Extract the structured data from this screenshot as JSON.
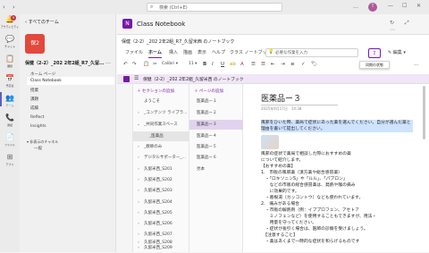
{
  "window": {
    "search_placeholder": "検索 (Ctrl+E)",
    "more": "…",
    "avatar_initial": "T",
    "min": "—",
    "max": "☐",
    "close": "✕"
  },
  "rail": {
    "notifications_badge": "9",
    "items": [
      {
        "label": "アクティビティ",
        "icon": "bell-icon",
        "glyph": "🔔"
      },
      {
        "label": "チャット",
        "icon": "chat-icon",
        "glyph": "💬"
      },
      {
        "label": "チーム",
        "icon": "teams-icon",
        "glyph": "👥"
      },
      {
        "label": "課題",
        "icon": "assignments-icon",
        "glyph": "📋"
      },
      {
        "label": "予定表",
        "icon": "calendar-icon",
        "glyph": "📅"
      },
      {
        "label": "通話",
        "icon": "phone-icon",
        "glyph": "📞"
      },
      {
        "label": "ファイル",
        "icon": "files-icon",
        "glyph": "📄"
      },
      {
        "label": "アプリ",
        "icon": "apps-icon",
        "glyph": "⊞"
      }
    ]
  },
  "team_pane": {
    "all_teams": "‹  すべてのチーム",
    "team_tile": "保2",
    "team_name": "保健（2-2）_202 2年2組_R7_久留...",
    "more": "…",
    "home_page": "ホーム ページ",
    "channels": [
      "Class Notebook",
      "授業",
      "課題",
      "成績",
      "Reflect",
      "Insights"
    ],
    "active_channel": "Class Notebook",
    "hidden_label": "▾ 非表示のチャネル",
    "hidden_item": "一般"
  },
  "app": {
    "icon_letter": "N",
    "title": "Class Notebook",
    "header_icons": "↻ ⤢ ⋯",
    "breadcrumb": "保健（2-2）_202 2年2組_R7_久留米西 のノートブック"
  },
  "ribbon": {
    "tabs": [
      "ファイル",
      "ホーム",
      "挿入",
      "描画",
      "表示",
      "ヘルプ",
      "クラス ノートブック"
    ],
    "active_tab": "ホーム",
    "search_placeholder": "必要な作業を入力",
    "share_glyph": "⇪",
    "edit_label": "✎ 編集 ▾",
    "tooltip": "同期の状態",
    "toolbar": [
      "↶",
      "↷",
      "📋",
      "✂",
      "Calibri ▾",
      "11 ▾",
      "B",
      "I",
      "U",
      "ab",
      "A",
      "☰",
      "☰",
      "⇤",
      "⇥",
      "≡",
      "✓",
      "🏷",
      "…"
    ]
  },
  "notebook": {
    "toggle": "☰",
    "title": "保健（2-2）_202 2年2組_久留米西 のノートブック",
    "add_section": "＋ セクションの追加",
    "add_page": "＋ ページの追加",
    "sections": [
      {
        "chev": "",
        "label": "ようこそ"
      },
      {
        "chev": "›",
        "label": "_コンテンツ ライブラ..."
      },
      {
        "chev": "⌄",
        "label": "_共同作業スペース"
      },
      {
        "chev": "",
        "label": "_医薬品"
      },
      {
        "chev": "›",
        "label": "_教師のみ"
      },
      {
        "chev": "›",
        "label": "デジタルサポーター_..."
      },
      {
        "chev": "›",
        "label": "久留米西_S201"
      },
      {
        "chev": "›",
        "label": "久留米西_S202"
      },
      {
        "chev": "›",
        "label": "久留米西_S203"
      },
      {
        "chev": "›",
        "label": "久留米西_S204"
      },
      {
        "chev": "›",
        "label": "久留米西_S205"
      },
      {
        "chev": "›",
        "label": "久留米西_S206"
      },
      {
        "chev": "›",
        "label": "久留米西_S207"
      },
      {
        "chev": "›",
        "label": "久留米西_S208"
      },
      {
        "chev": "›",
        "label": "久留米西_S209"
      }
    ],
    "active_section": "_医薬品",
    "pages": [
      "医薬品ー１",
      "医薬品ー２",
      "医薬品ー３",
      "医薬品ー４",
      "医薬品ー５",
      "医薬品ー６",
      "見本"
    ],
    "active_page": "医薬品ー３"
  },
  "page": {
    "title": "医薬品ー３",
    "date": "2025年9月17日　14:38",
    "selected_text": "風邪をひいた時、薬局で症状にあった薬を選んでください。自分が選んだ薬と理由を書いて提出してください。",
    "lines": [
      "風邪の症状で薬局で相談した際におすすめの薬",
      "について紹介します。",
      "【おすすめの薬】",
      "1.　市販の風邪薬（漢方薬や総合感冒薬）",
      "　・「ロキソニンS」や「ルル」、「パブロン」",
      "　　などの市販の総合感冒薬は、発熱や喉の痛み",
      "　　に効果的です。",
      "　・葛根湯（カッコントウ）なども使われています。",
      "2.　痛みがある場合",
      "　・市販の解熱剤（例：イブプロフェン、アセトア",
      "　　ミノフェンなど）を使用することもできますが、用法・",
      "　　用量を守ってください。",
      "　・症状が長引く場合は、医師の診察を受けましょう。",
      "　【注意すること】",
      "　・薬はあくまで一時的な症状を和らげるものです"
    ]
  }
}
